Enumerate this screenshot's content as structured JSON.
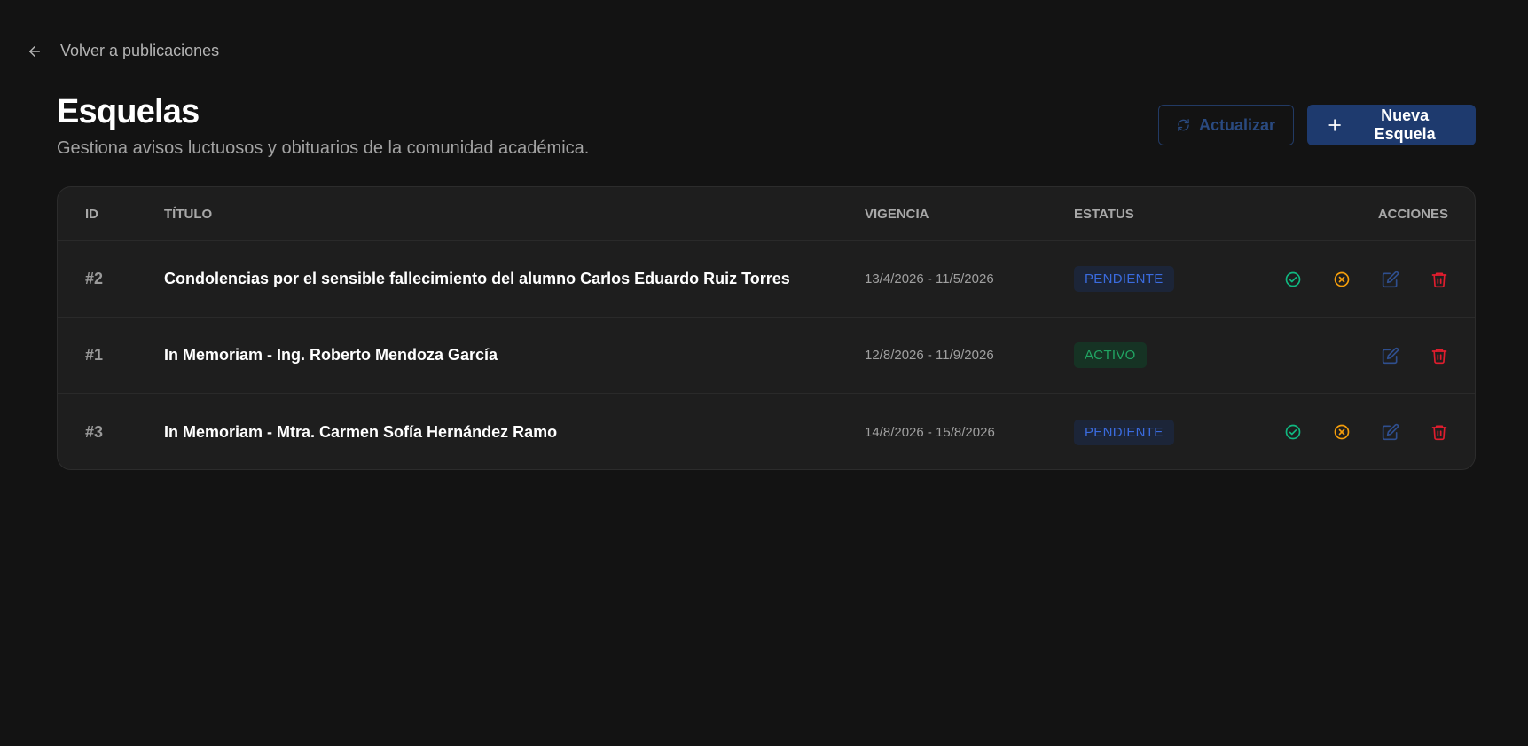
{
  "nav": {
    "back_label": "Volver a publicaciones"
  },
  "header": {
    "title": "Esquelas",
    "subtitle": "Gestiona avisos luctuosos y obituarios de la comunidad académica.",
    "refresh_label": "Actualizar",
    "new_label": "Nueva Esquela"
  },
  "table": {
    "columns": {
      "id": "ID",
      "title": "TÍTULO",
      "vigencia": "VIGENCIA",
      "status": "ESTATUS",
      "actions": "ACCIONES"
    },
    "rows": [
      {
        "id": "#2",
        "title": "Condolencias por el sensible fallecimiento del alumno Carlos Eduardo Ruiz Torres",
        "vigencia": "13/4/2026 - 11/5/2026",
        "status": "PENDIENTE"
      },
      {
        "id": "#1",
        "title": "In Memoriam - Ing. Roberto Mendoza García",
        "vigencia": "12/8/2026 - 11/9/2026",
        "status": "ACTIVO"
      },
      {
        "id": "#3",
        "title": "In Memoriam - Mtra. Carmen Sofía Hernández Ramo",
        "vigencia": "14/8/2026 - 15/8/2026",
        "status": "PENDIENTE"
      }
    ]
  },
  "colors": {
    "background": "#131313",
    "card": "#1e1e1e",
    "primary": "#1e3a6e",
    "approve": "#10b981",
    "reject": "#f59e0b",
    "edit": "#2f4f8f",
    "delete": "#e11d2e"
  },
  "icons": [
    "arrow-left-icon",
    "refresh-icon",
    "plus-icon",
    "check-circle-icon",
    "x-circle-icon",
    "edit-icon",
    "trash-icon"
  ]
}
